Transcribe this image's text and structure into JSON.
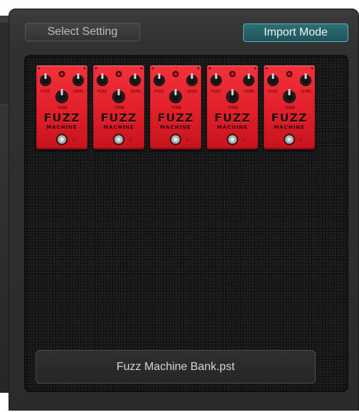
{
  "toolbar": {
    "select_setting_label": "Select Setting",
    "import_mode_label": "Import Mode"
  },
  "pedal_board": {
    "pedals": [
      {
        "name": "Fuzz Machine",
        "title_top": "FUZZ",
        "title_bottom": "MACHINE",
        "knob_labels": {
          "left": "FUZZ",
          "right": "LEVEL",
          "center": "TONE"
        },
        "channel": "2"
      },
      {
        "name": "Fuzz Machine",
        "title_top": "FUZZ",
        "title_bottom": "MACHINE",
        "knob_labels": {
          "left": "FUZZ",
          "right": "LEVEL",
          "center": "TONE"
        },
        "channel": "2"
      },
      {
        "name": "Fuzz Machine",
        "title_top": "FUZZ",
        "title_bottom": "MACHINE",
        "knob_labels": {
          "left": "FUZZ",
          "right": "LEVEL",
          "center": "TONE"
        },
        "channel": "2"
      },
      {
        "name": "Fuzz Machine",
        "title_top": "FUZZ",
        "title_bottom": "MACHINE",
        "knob_labels": {
          "left": "FUZZ",
          "right": "LEVEL",
          "center": "TONE"
        },
        "channel": "2"
      },
      {
        "name": "Fuzz Machine",
        "title_top": "FUZZ",
        "title_bottom": "MACHINE",
        "knob_labels": {
          "left": "FUZZ",
          "right": "LEVEL",
          "center": "TONE"
        },
        "channel": "2"
      }
    ]
  },
  "file": {
    "name": "Fuzz Machine Bank.pst"
  },
  "colors": {
    "pedal_red": "#e01f2a",
    "import_button_teal": "#2d6f77",
    "panel_dark": "#2b2b2b"
  },
  "icons": {
    "knob": "knob-icon",
    "footswitch": "footswitch-icon",
    "led": "led-icon"
  }
}
